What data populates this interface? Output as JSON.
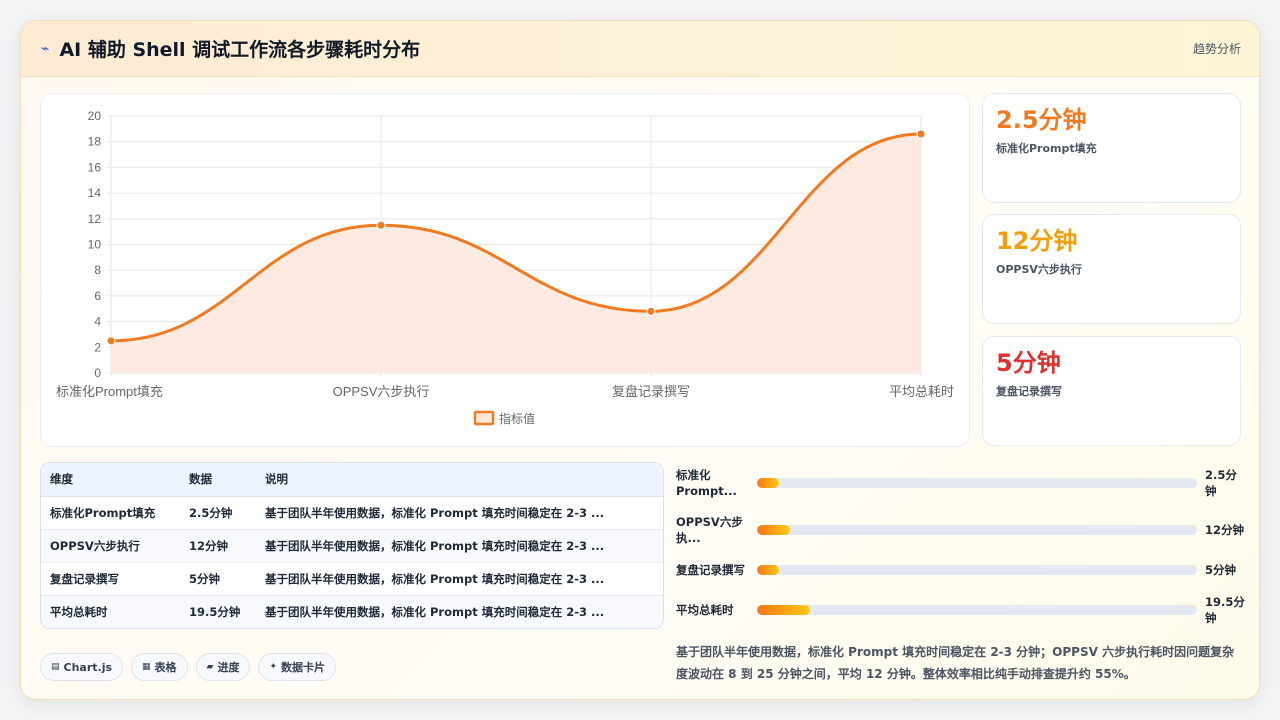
{
  "header": {
    "icon": "pulse-icon",
    "title": "AI 辅助 Shell 调试工作流各步骤耗时分布",
    "action": "趋势分析"
  },
  "chart_data": {
    "type": "area",
    "categories": [
      "标准化Prompt填充",
      "OPPSV六步执行",
      "复盘记录撰写",
      "平均总耗时"
    ],
    "series": [
      {
        "name": "指标值",
        "values": [
          2.5,
          11.5,
          4.8,
          18.6
        ]
      }
    ],
    "yticks": [
      "0",
      "2",
      "4",
      "6",
      "8",
      "10",
      "12",
      "14",
      "16",
      "18",
      "20"
    ],
    "ylim": [
      0,
      20
    ],
    "grid": true,
    "legend": "bottom",
    "colors": {
      "line": "#f07a22",
      "fill": "#fde8dc"
    }
  },
  "stats": [
    {
      "value": "2.5分钟",
      "label": "标准化Prompt填充",
      "color": "#f07a22"
    },
    {
      "value": "12分钟",
      "label": "OPPSV六步执行",
      "color": "#f59e0b"
    },
    {
      "value": "5分钟",
      "label": "复盘记录撰写",
      "color": "#e03131"
    }
  ],
  "table": {
    "headers": [
      "维度",
      "数据",
      "说明"
    ],
    "rows": [
      [
        "标准化Prompt填充",
        "2.5分钟",
        "基于团队半年使用数据，标准化 Prompt 填充时间稳定在 2-3 ..."
      ],
      [
        "OPPSV六步执行",
        "12分钟",
        "基于团队半年使用数据，标准化 Prompt 填充时间稳定在 2-3 ..."
      ],
      [
        "复盘记录撰写",
        "5分钟",
        "基于团队半年使用数据，标准化 Prompt 填充时间稳定在 2-3 ..."
      ],
      [
        "平均总耗时",
        "19.5分钟",
        "基于团队半年使用数据，标准化 Prompt 填充时间稳定在 2-3 ..."
      ]
    ]
  },
  "progress": [
    {
      "label": "标准化Prompt...",
      "value": "2.5分钟",
      "fraction": 0.05
    },
    {
      "label": "OPPSV六步执...",
      "value": "12分钟",
      "fraction": 0.075
    },
    {
      "label": "复盘记录撰写",
      "value": "5分钟",
      "fraction": 0.05
    },
    {
      "label": "平均总耗时",
      "value": "19.5分钟",
      "fraction": 0.12
    }
  ],
  "note": "基于团队半年使用数据，标准化 Prompt 填充时间稳定在 2-3 分钟；OPPSV 六步执行耗时因问题复杂度波动在 8 到 25 分钟之间，平均 12 分钟。整体效率相比纯手动排查提升约 55%。",
  "tags": [
    {
      "icon": "chart-icon",
      "glyph": "▤",
      "label": "Chart.js"
    },
    {
      "icon": "table-icon",
      "glyph": "▦",
      "label": "表格"
    },
    {
      "icon": "progress-icon",
      "glyph": "▰",
      "label": "进度"
    },
    {
      "icon": "sparkle-icon",
      "glyph": "✦",
      "label": "数据卡片"
    }
  ]
}
